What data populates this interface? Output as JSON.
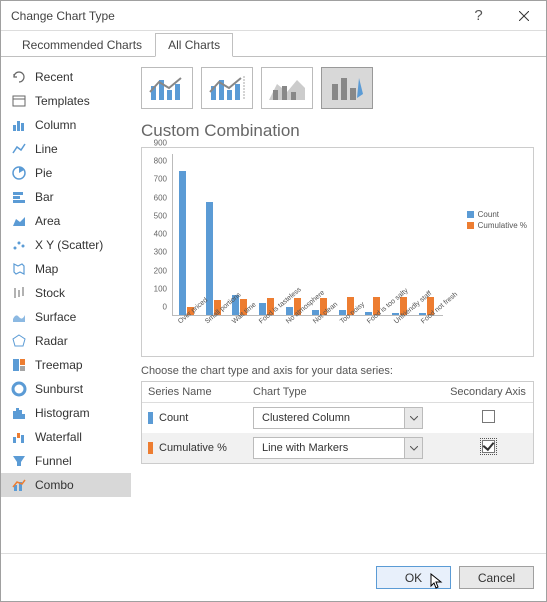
{
  "titlebar": {
    "title": "Change Chart Type"
  },
  "tabs": {
    "recommended": "Recommended Charts",
    "all": "All Charts"
  },
  "sidebar": {
    "items": [
      {
        "label": "Recent"
      },
      {
        "label": "Templates"
      },
      {
        "label": "Column"
      },
      {
        "label": "Line"
      },
      {
        "label": "Pie"
      },
      {
        "label": "Bar"
      },
      {
        "label": "Area"
      },
      {
        "label": "X Y (Scatter)"
      },
      {
        "label": "Map"
      },
      {
        "label": "Stock"
      },
      {
        "label": "Surface"
      },
      {
        "label": "Radar"
      },
      {
        "label": "Treemap"
      },
      {
        "label": "Sunburst"
      },
      {
        "label": "Histogram"
      },
      {
        "label": "Waterfall"
      },
      {
        "label": "Funnel"
      },
      {
        "label": "Combo"
      }
    ]
  },
  "main": {
    "section_title": "Custom Combination",
    "choose_label": "Choose the chart type and axis for your data series:",
    "headers": {
      "name": "Series Name",
      "type": "Chart Type",
      "axis": "Secondary Axis"
    },
    "series": [
      {
        "name": "Count",
        "chart_type": "Clustered Column",
        "secondary": false,
        "color": "#5b9bd5"
      },
      {
        "name": "Cumulative %",
        "chart_type": "Line with Markers",
        "secondary": true,
        "color": "#ed7d31"
      }
    ]
  },
  "footer": {
    "ok": "OK",
    "cancel": "Cancel"
  },
  "chart_data": {
    "type": "bar",
    "title": "Custom Combination",
    "categories": [
      "Over priced",
      "Small portions",
      "Wait time",
      "Food is tasteless",
      "No atmosphere",
      "Not clean",
      "Too noisy",
      "Food is too salty",
      "Unfriendly staff",
      "Food not fresh"
    ],
    "series": [
      {
        "name": "Count",
        "values": [
          789,
          621,
          109,
          65,
          45,
          30,
          27,
          15,
          12,
          9
        ],
        "color": "#5b9bd5"
      },
      {
        "name": "Cumulative %",
        "values": [
          45,
          80,
          87,
          91,
          94,
          95,
          97,
          98,
          99,
          100
        ],
        "color": "#ed7d31"
      }
    ],
    "ylabel": "",
    "ylim": [
      0,
      900
    ],
    "y_ticks": [
      0,
      100,
      200,
      300,
      400,
      500,
      600,
      700,
      800,
      900
    ],
    "legend_position": "right"
  }
}
